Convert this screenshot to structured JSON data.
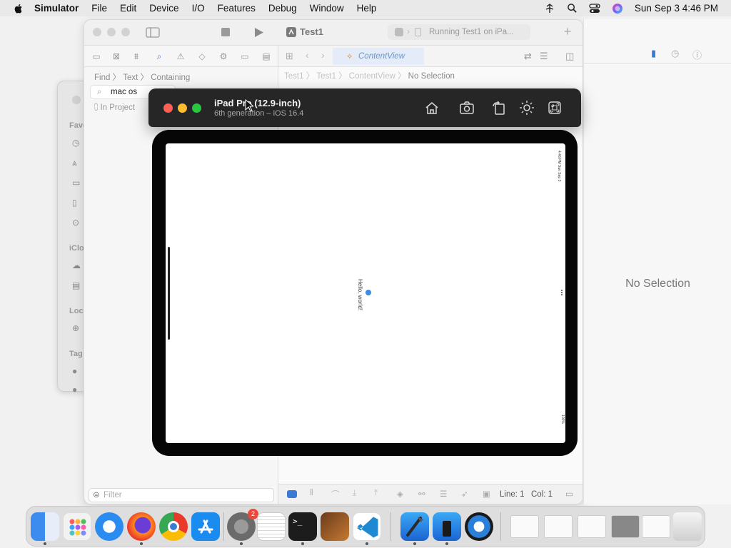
{
  "menubar": {
    "app_name": "Simulator",
    "items": [
      "File",
      "Edit",
      "Device",
      "I/O",
      "Features",
      "Debug",
      "Window",
      "Help"
    ],
    "clock": "Sun Sep 3  4:46 PM"
  },
  "finder": {
    "labels": [
      "Favo",
      "iClo",
      "Loc",
      "Tag"
    ]
  },
  "xcode": {
    "scheme": "Test1",
    "status": "Running Test1 on iPa...",
    "find_row": {
      "find": "Find",
      "text": "Text",
      "containing": "Containing"
    },
    "search_value": "mac os",
    "in_project": "In Project",
    "filter_placeholder": "Filter",
    "tab_label": "ContentView",
    "jump_bar": {
      "p1": "Test1",
      "p2": "Test1",
      "p3": "ContentView",
      "p4": "No Selection"
    },
    "debug_line": "Line: 1",
    "debug_col": "Col: 1"
  },
  "inspector": {
    "no_selection": "No Selection"
  },
  "simulator": {
    "device_name": "iPad Pro (12.9-inch)",
    "device_sub": "6th generation – iOS 16.4",
    "screen_text": "Hello, world!",
    "status_time": "4:46 PM  Sun Sep 3",
    "battery": "100%"
  },
  "dock": {
    "badge_settings": "2",
    "apps": [
      "finder",
      "launchpad",
      "safari",
      "firefox",
      "chrome",
      "app-store",
      "system-settings",
      "textedit",
      "terminal",
      "garageband",
      "vscode",
      "xcode",
      "simulator",
      "quicktime"
    ]
  },
  "colors": {
    "accent": "#3a7bd5",
    "red": "#ff5f57",
    "yellow": "#febc2e",
    "green": "#28c840"
  }
}
